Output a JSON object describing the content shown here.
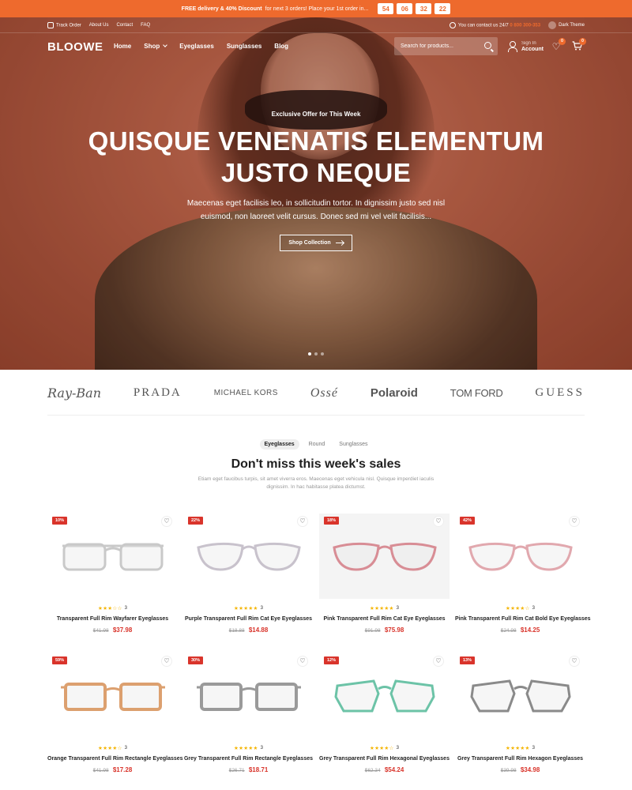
{
  "promo": {
    "text_strong": "FREE delivery & 40% Discount",
    "text": "for next 3 orders! Place your 1st order in...",
    "countdown": [
      "54",
      "06",
      "32",
      "22"
    ]
  },
  "topbar": {
    "links": [
      "Track Order",
      "About Us",
      "Contact",
      "FAQ"
    ],
    "contact_text": "You can contact us 24/7",
    "phone": "0 800 300-353",
    "dark_theme": "Dark Theme"
  },
  "header": {
    "logo": "BLOOWE",
    "menu": [
      "Home",
      "Shop",
      "Eyeglasses",
      "Sunglasses",
      "Blog"
    ],
    "search_placeholder": "Search for products...",
    "sign_in": "Sign In",
    "account": "Account",
    "wishlist_count": "0",
    "cart_count": "0"
  },
  "hero": {
    "eyebrow": "Exclusive Offer for This Week",
    "headline_line1": "QUISQUE VENENATIS ELEMENTUM",
    "headline_line2": "JUSTO NEQUE",
    "subtitle": "Maecenas eget facilisis leo, in sollicitudin tortor. In dignissim justo sed nisl euismod, non laoreet velit cursus. Donec sed mi vel velit facilisis...",
    "cta": "Shop Collection",
    "slides": 3,
    "active_slide": 1
  },
  "brands": [
    "Ray-Ban",
    "PRADA",
    "MICHAEL KORS",
    "Ossé",
    "Polaroid",
    "TOM FORD",
    "GUESS"
  ],
  "sales": {
    "tabs": [
      "Eyeglasses",
      "Round",
      "Sunglasses"
    ],
    "active_tab": "Eyeglasses",
    "title": "Don't miss this week's sales",
    "description": "Etiam eget faucibus turpis, sit amet viverra eros. Maecenas eget vehicula nisl. Quisque imperdiet iaculis dignissim. In hac habitasse platea dictumst."
  },
  "colors": {
    "accent": "#ee6a2d",
    "sale": "#d9342b",
    "star": "#f4b400"
  },
  "products": [
    {
      "discount": "10%",
      "rating": 3,
      "reviews": "3",
      "title": "Transparent Full Rim Wayfarer Eyeglasses",
      "old_price": "$41.98",
      "price": "$37.98",
      "frame_color": "#c9c9c9",
      "shape": "wayfarer",
      "grey": false
    },
    {
      "discount": "22%",
      "rating": 5,
      "reviews": "3",
      "title": "Purple Transparent Full Rim Cat Eye Eyeglasses",
      "old_price": "$18.88",
      "price": "$14.88",
      "frame_color": "#c8c2cc",
      "shape": "cateye",
      "grey": false
    },
    {
      "discount": "18%",
      "rating": 5,
      "reviews": "3",
      "title": "Pink Transparent Full Rim Cat Eye Eyeglasses",
      "old_price": "$91.98",
      "price": "$75.98",
      "frame_color": "#d88d95",
      "shape": "cateye",
      "grey": true
    },
    {
      "discount": "42%",
      "rating": 4,
      "reviews": "3",
      "title": "Pink Transparent Full Rim Cat Bold Eye Eyeglasses",
      "old_price": "$24.98",
      "price": "$14.25",
      "frame_color": "#e1a8ae",
      "shape": "cateye",
      "grey": false
    },
    {
      "discount": "59%",
      "rating": 4,
      "reviews": "3",
      "title": "Orange Transparent Full Rim Rectangle Eyeglasses",
      "old_price": "$41.98",
      "price": "$17.28",
      "frame_color": "#dca06f",
      "shape": "rect",
      "grey": false
    },
    {
      "discount": "30%",
      "rating": 5,
      "reviews": "3",
      "title": "Grey Transparent Full Rim Rectangle Eyeglasses",
      "old_price": "$26.71",
      "price": "$18.71",
      "frame_color": "#9a9a9a",
      "shape": "rect",
      "grey": false
    },
    {
      "discount": "12%",
      "rating": 4,
      "reviews": "3",
      "title": "Grey Transparent Full Rim Hexagonal Eyeglasses",
      "old_price": "$62.34",
      "price": "$54.24",
      "frame_color": "#6cc3a7",
      "shape": "hex",
      "grey": false
    },
    {
      "discount": "13%",
      "rating": 5,
      "reviews": "3",
      "title": "Grey Transparent Full Rim Hexagon Eyeglasses",
      "old_price": "$39.98",
      "price": "$34.98",
      "frame_color": "#8a8a8a",
      "shape": "hex",
      "grey": false
    }
  ]
}
